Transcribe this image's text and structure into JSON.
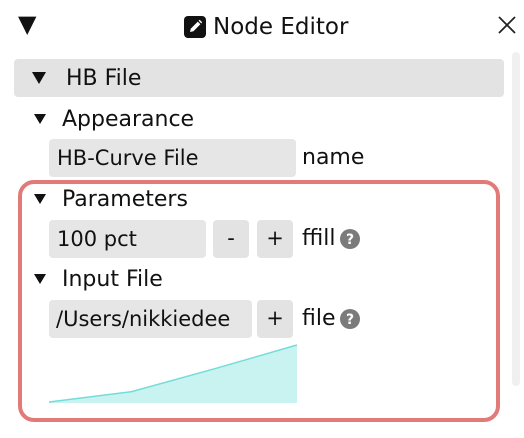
{
  "window": {
    "title": "Node Editor",
    "title_icon": "pencil-icon",
    "close_icon": "close-icon",
    "collapse_icon": "triangle-down-icon"
  },
  "node": {
    "header_label": "HB File",
    "appearance": {
      "label": "Appearance",
      "name_value": "HB-Curve File",
      "name_label": "name"
    },
    "parameters": {
      "label": "Parameters",
      "ffill_value": "100 pct",
      "minus_label": "-",
      "plus_label": "+",
      "ffill_label": "ffill"
    },
    "input_file": {
      "label": "Input File",
      "file_value": "/Users/nikkiedee",
      "plus_label": "+",
      "file_label": "file"
    }
  },
  "colors": {
    "highlight_border": "#e27a77",
    "sparkline_fill": "#c9f3f1",
    "sparkline_stroke": "#74dcd8",
    "field_bg": "#e6e6e6"
  },
  "chart_data": {
    "type": "area",
    "x": [
      0,
      1,
      2,
      3
    ],
    "values": [
      0,
      1,
      3.2,
      5.5
    ],
    "title": "",
    "xlabel": "",
    "ylabel": ""
  }
}
